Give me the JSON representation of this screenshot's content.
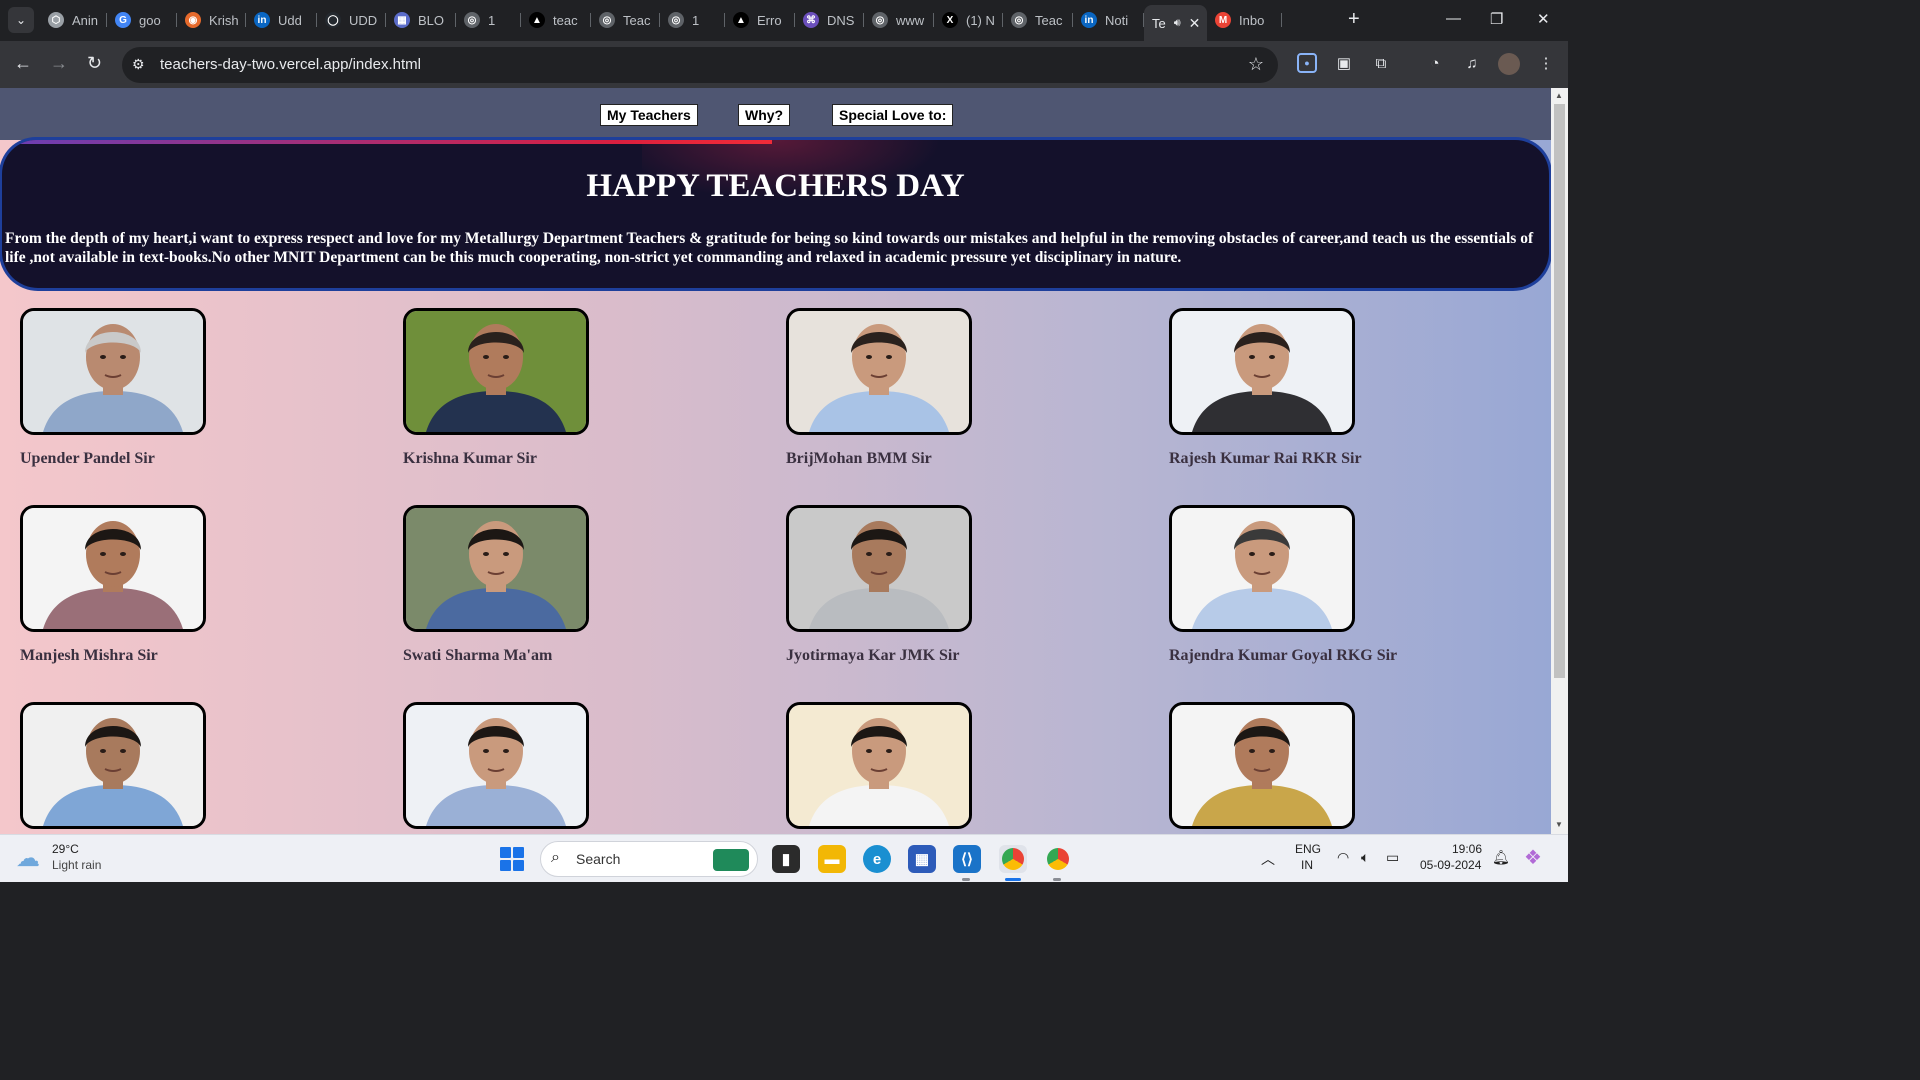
{
  "browser": {
    "tabs": [
      {
        "title": "Anin",
        "fav_color": "#9aa0a6",
        "fav_glyph": "⬡"
      },
      {
        "title": "goo",
        "fav_color": "#4285f4",
        "fav_glyph": "G"
      },
      {
        "title": "Krish",
        "fav_color": "#e66a2c",
        "fav_glyph": "◉"
      },
      {
        "title": "Udd",
        "fav_color": "#0a66c2",
        "fav_glyph": "in"
      },
      {
        "title": "UDD",
        "fav_color": "#24292f",
        "fav_glyph": "◯"
      },
      {
        "title": "BLO",
        "fav_color": "#5b6cc9",
        "fav_glyph": "▦"
      },
      {
        "title": "1",
        "fav_color": "#5f6368",
        "fav_glyph": "◎"
      },
      {
        "title": "teac",
        "fav_color": "#000000",
        "fav_glyph": "▲"
      },
      {
        "title": "Teac",
        "fav_color": "#5f6368",
        "fav_glyph": "◎"
      },
      {
        "title": "1",
        "fav_color": "#5f6368",
        "fav_glyph": "◎"
      },
      {
        "title": "Erro",
        "fav_color": "#000000",
        "fav_glyph": "▲"
      },
      {
        "title": "DNS",
        "fav_color": "#6b4fbb",
        "fav_glyph": "⌘"
      },
      {
        "title": "www",
        "fav_color": "#5f6368",
        "fav_glyph": "◎"
      },
      {
        "title": "(1) N",
        "fav_color": "#000000",
        "fav_glyph": "X"
      },
      {
        "title": "Teac",
        "fav_color": "#5f6368",
        "fav_glyph": "◎"
      },
      {
        "title": "Noti",
        "fav_color": "#0a66c2",
        "fav_glyph": "in"
      },
      {
        "title": "Te",
        "active": true
      },
      {
        "title": "Inbo",
        "fav_color": "#ea4335",
        "fav_glyph": "M"
      }
    ],
    "url": "teachers-day-two.vercel.app/index.html"
  },
  "site": {
    "nav": [
      "My Teachers",
      "Why?",
      "Special Love to:"
    ],
    "title": "HAPPY TEACHERS DAY",
    "message": "From the depth of my heart,i want to express respect and love for my Metallurgy Department Teachers & gratitude for being so kind towards our mistakes and helpful in the removing obstacles of career,and teach us the essentials of life ,not available in text-books.No other MNIT Department can be this much cooperating, non-strict yet commanding and relaxed in academic pressure yet disciplinary in nature.",
    "teachers": [
      {
        "name": "Upender Pandel Sir",
        "bg": "#dfe3e6",
        "shirt": "#8fa7c9",
        "skin": "#b98a70",
        "hair": "#c9c9c9"
      },
      {
        "name": "Krishna Kumar Sir",
        "bg": "#6f8f3a",
        "shirt": "#23324f",
        "skin": "#b07b5c",
        "hair": "#2a211d"
      },
      {
        "name": "BrijMohan BMM Sir",
        "bg": "#e7e2dc",
        "shirt": "#a9c3e6",
        "skin": "#c99a7d",
        "hair": "#2a211d"
      },
      {
        "name": "Rajesh Kumar Rai RKR Sir",
        "bg": "#eef1f5",
        "shirt": "#2f2f33",
        "skin": "#c99a7d",
        "hair": "#2a211d"
      },
      {
        "name": "Manjesh Mishra Sir",
        "bg": "#f4f4f4",
        "shirt": "#9a6f78",
        "skin": "#b07b5c",
        "hair": "#1c1714"
      },
      {
        "name": "Swati Sharma Ma'am",
        "bg": "#7b8a6a",
        "shirt": "#4b6aa0",
        "skin": "#c99a7d",
        "hair": "#1c1714"
      },
      {
        "name": "Jyotirmaya Kar JMK Sir",
        "bg": "#c9c9c9",
        "shirt": "#b9bcc0",
        "skin": "#a87a5d",
        "hair": "#1c1714"
      },
      {
        "name": "Rajendra Kumar Goyal RKG Sir",
        "bg": "#f4f4f4",
        "shirt": "#b7cbe8",
        "skin": "#c99a7d",
        "hair": "#3a3a3a"
      },
      {
        "name": "",
        "bg": "#f0f0f0",
        "shirt": "#7fa6d6",
        "skin": "#a87a5d",
        "hair": "#1c1714"
      },
      {
        "name": "",
        "bg": "#eef1f5",
        "shirt": "#9ab0d6",
        "skin": "#c99a7d",
        "hair": "#1c1714"
      },
      {
        "name": "",
        "bg": "#f4ead2",
        "shirt": "#f4f4f4",
        "skin": "#c99a7d",
        "hair": "#1c1714"
      },
      {
        "name": "",
        "bg": "#f4f4f4",
        "shirt": "#c9a64a",
        "skin": "#b07b5c",
        "hair": "#1c1714"
      }
    ]
  },
  "taskbar": {
    "temperature": "29°C",
    "weather": "Light rain",
    "search_label": "Search",
    "lang1": "ENG",
    "lang2": "IN",
    "time": "19:06",
    "date": "05-09-2024"
  }
}
